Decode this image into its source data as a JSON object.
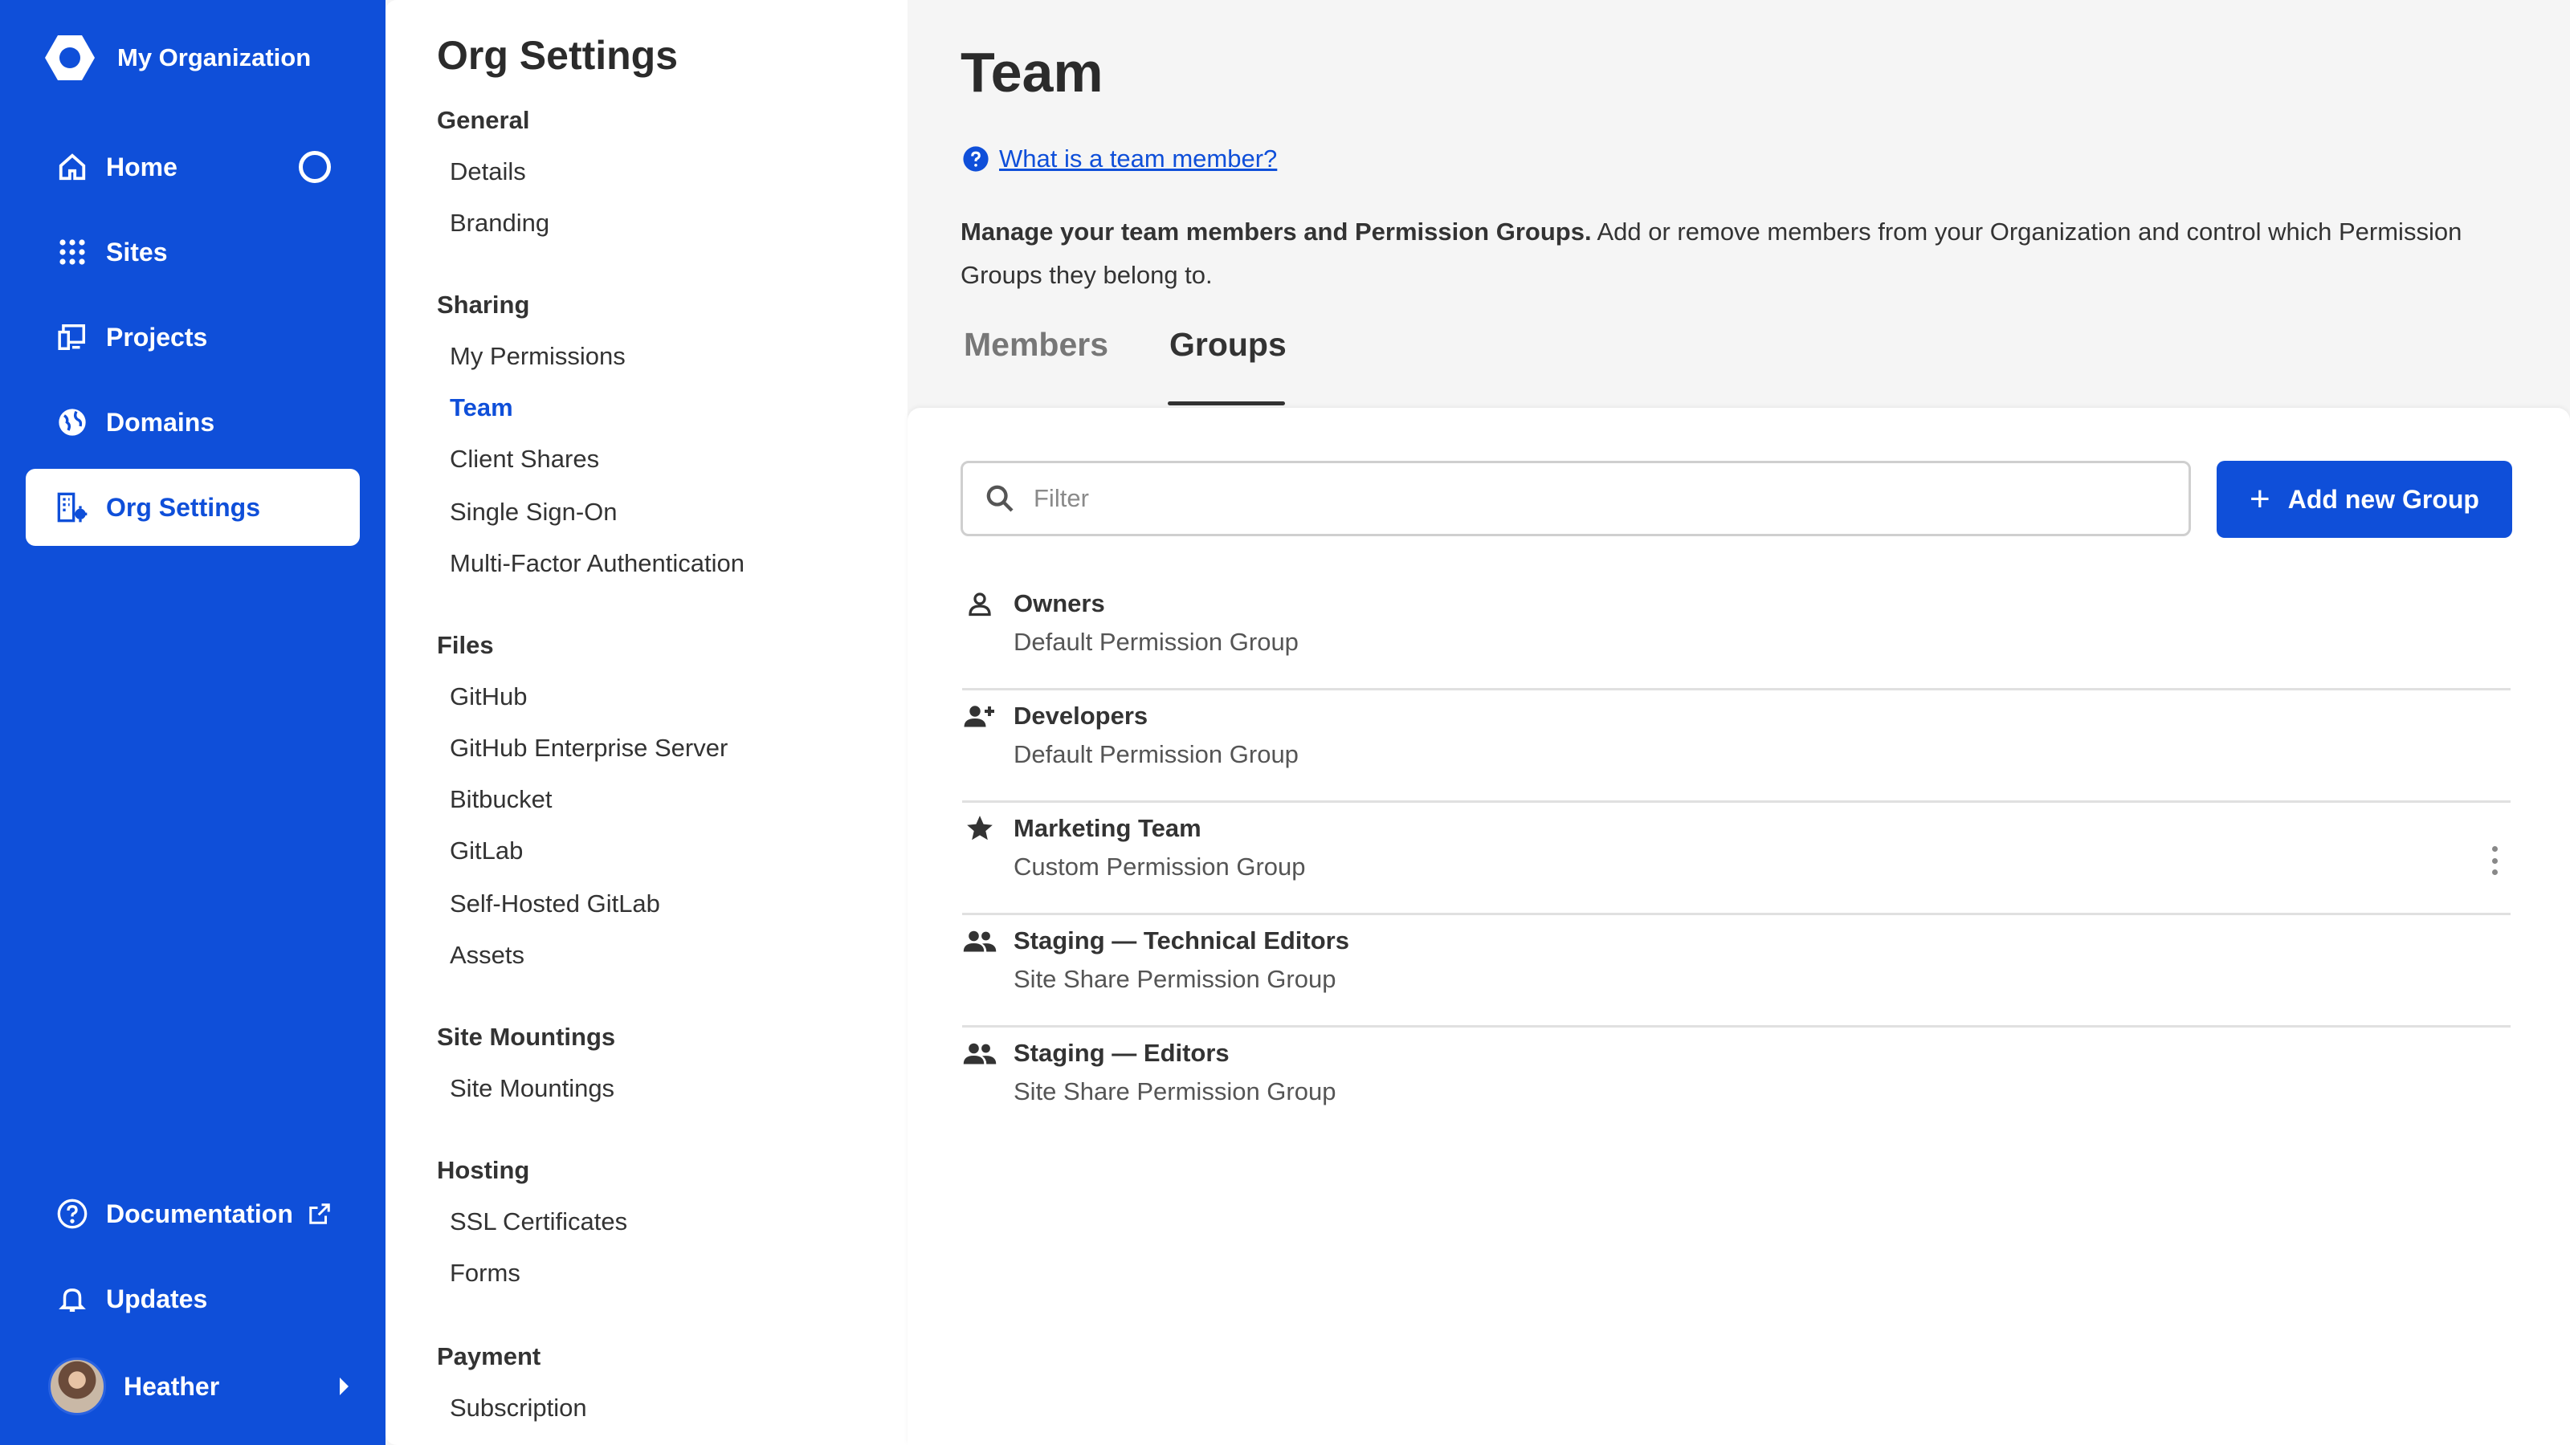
{
  "org": {
    "name": "My Organization"
  },
  "left_nav": {
    "items": [
      {
        "label": "Home",
        "icon": "home-icon"
      },
      {
        "label": "Sites",
        "icon": "grid-icon"
      },
      {
        "label": "Projects",
        "icon": "projects-icon"
      },
      {
        "label": "Domains",
        "icon": "globe-icon"
      },
      {
        "label": "Org Settings",
        "icon": "org-settings-icon",
        "active": true
      }
    ],
    "bottom": [
      {
        "label": "Documentation",
        "icon": "help-circle-icon"
      },
      {
        "label": "Updates",
        "icon": "bell-icon"
      }
    ],
    "user": {
      "name": "Heather"
    }
  },
  "settings_nav": {
    "title": "Org Settings",
    "sections": [
      {
        "heading": "General",
        "links": [
          "Details",
          "Branding"
        ]
      },
      {
        "heading": "Sharing",
        "links": [
          "My Permissions",
          "Team",
          "Client Shares",
          "Single Sign-On",
          "Multi-Factor Authentication"
        ]
      },
      {
        "heading": "Files",
        "links": [
          "GitHub",
          "GitHub Enterprise Server",
          "Bitbucket",
          "GitLab",
          "Self-Hosted GitLab",
          "Assets"
        ]
      },
      {
        "heading": "Site Mountings",
        "links": [
          "Site Mountings"
        ]
      },
      {
        "heading": "Hosting",
        "links": [
          "SSL Certificates",
          "Forms"
        ]
      },
      {
        "heading": "Payment",
        "links": [
          "Subscription"
        ]
      }
    ],
    "active_link": "Team"
  },
  "main": {
    "title": "Team",
    "help_link": "What is a team member?",
    "description_bold": "Manage your team members and Permission Groups.",
    "description_rest": " Add or remove members from your Organization and control which Permission Groups they belong to.",
    "tabs": [
      {
        "label": "Members",
        "active": false
      },
      {
        "label": "Groups",
        "active": true
      }
    ],
    "filter_placeholder": "Filter",
    "add_button_label": "Add new Group",
    "groups": [
      {
        "name": "Owners",
        "type": "Default Permission Group",
        "icon": "person-icon"
      },
      {
        "name": "Developers",
        "type": "Default Permission Group",
        "icon": "person-add-icon"
      },
      {
        "name": "Marketing Team",
        "type": "Custom Permission Group",
        "icon": "star-icon",
        "has_menu": true
      },
      {
        "name": "Staging — Technical Editors",
        "type": "Site Share Permission Group",
        "icon": "people-icon"
      },
      {
        "name": "Staging — Editors",
        "type": "Site Share Permission Group",
        "icon": "people-icon"
      }
    ]
  },
  "colors": {
    "brand_blue": "#0f4fd9",
    "panel_bg": "#ffffff",
    "page_bg": "#f5f5f5"
  }
}
